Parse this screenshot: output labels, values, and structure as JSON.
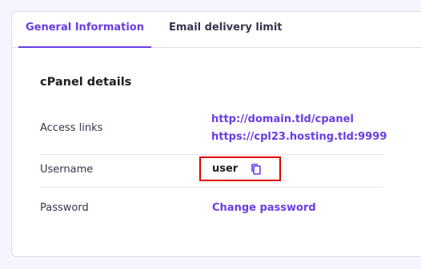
{
  "tabs": [
    {
      "label": "General Information",
      "active": true
    },
    {
      "label": "Email delivery limit",
      "active": false
    }
  ],
  "cpanel": {
    "title": "cPanel details",
    "access_links_label": "Access links",
    "access_links": [
      "http://domain.tld/cpanel",
      "https://cpl23.hosting.tld:9999"
    ],
    "username_label": "Username",
    "username_value": "user",
    "password_label": "Password",
    "change_password_label": "Change password"
  },
  "colors": {
    "accent": "#673de6",
    "highlight_box": "#e30000",
    "background": "#f4f5ff"
  },
  "icons": {
    "copy": "copy-icon"
  }
}
